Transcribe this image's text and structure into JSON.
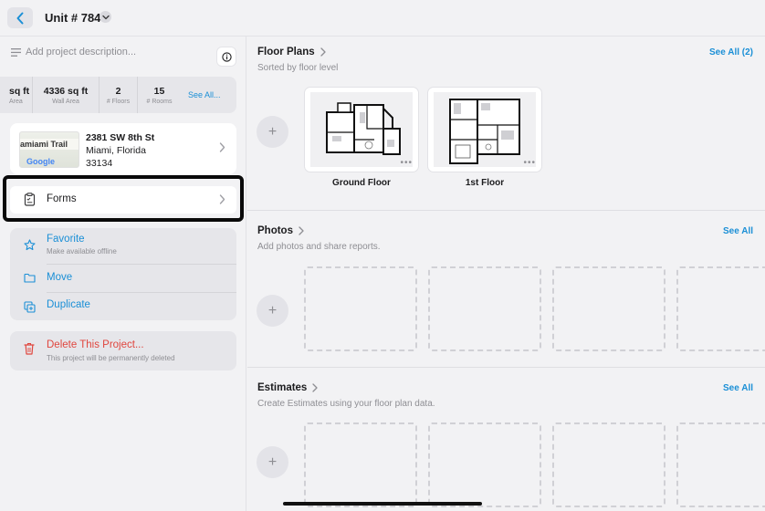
{
  "header": {
    "title": "Unit # 784"
  },
  "project": {
    "description_placeholder": "Add project description..."
  },
  "stats": {
    "items": [
      {
        "value": "sq ft",
        "label": "Area"
      },
      {
        "value": "4336 sq ft",
        "label": "Wall Area"
      },
      {
        "value": "2",
        "label": "# Floors"
      },
      {
        "value": "15",
        "label": "# Rooms"
      }
    ],
    "see_all": "See All..."
  },
  "address": {
    "line1": "2381 SW 8th St",
    "line2": "Miami, Florida",
    "line3": "33134",
    "map_text": "amiami Trail",
    "map_brand": "Google"
  },
  "forms": {
    "label": "Forms"
  },
  "actions": {
    "favorite": {
      "label": "Favorite",
      "sub": "Make available offline"
    },
    "move": {
      "label": "Move"
    },
    "duplicate": {
      "label": "Duplicate"
    }
  },
  "delete": {
    "label": "Delete This Project...",
    "sub": "This project will be permanently deleted"
  },
  "sections": {
    "floor_plans": {
      "title": "Floor Plans",
      "subtitle": "Sorted by floor level",
      "see_all": "See All (2)",
      "plans": [
        {
          "name": "Ground Floor"
        },
        {
          "name": "1st Floor"
        }
      ]
    },
    "photos": {
      "title": "Photos",
      "subtitle": "Add photos and share reports.",
      "see_all": "See All"
    },
    "estimates": {
      "title": "Estimates",
      "subtitle": "Create Estimates using your floor plan data.",
      "see_all": "See All"
    }
  },
  "colors": {
    "accent": "#1a8fd6",
    "danger": "#e0463e",
    "highlight_border": "#0a0a0a"
  },
  "icons": {
    "back": "chevron-left-icon",
    "title_menu": "chevron-down-icon",
    "description": "lines-icon",
    "info": "info-icon",
    "forms": "clipboard-icon",
    "favorite": "star-icon",
    "move": "folder-icon",
    "duplicate": "duplicate-icon",
    "delete": "trash-icon",
    "add": "plus-icon"
  }
}
